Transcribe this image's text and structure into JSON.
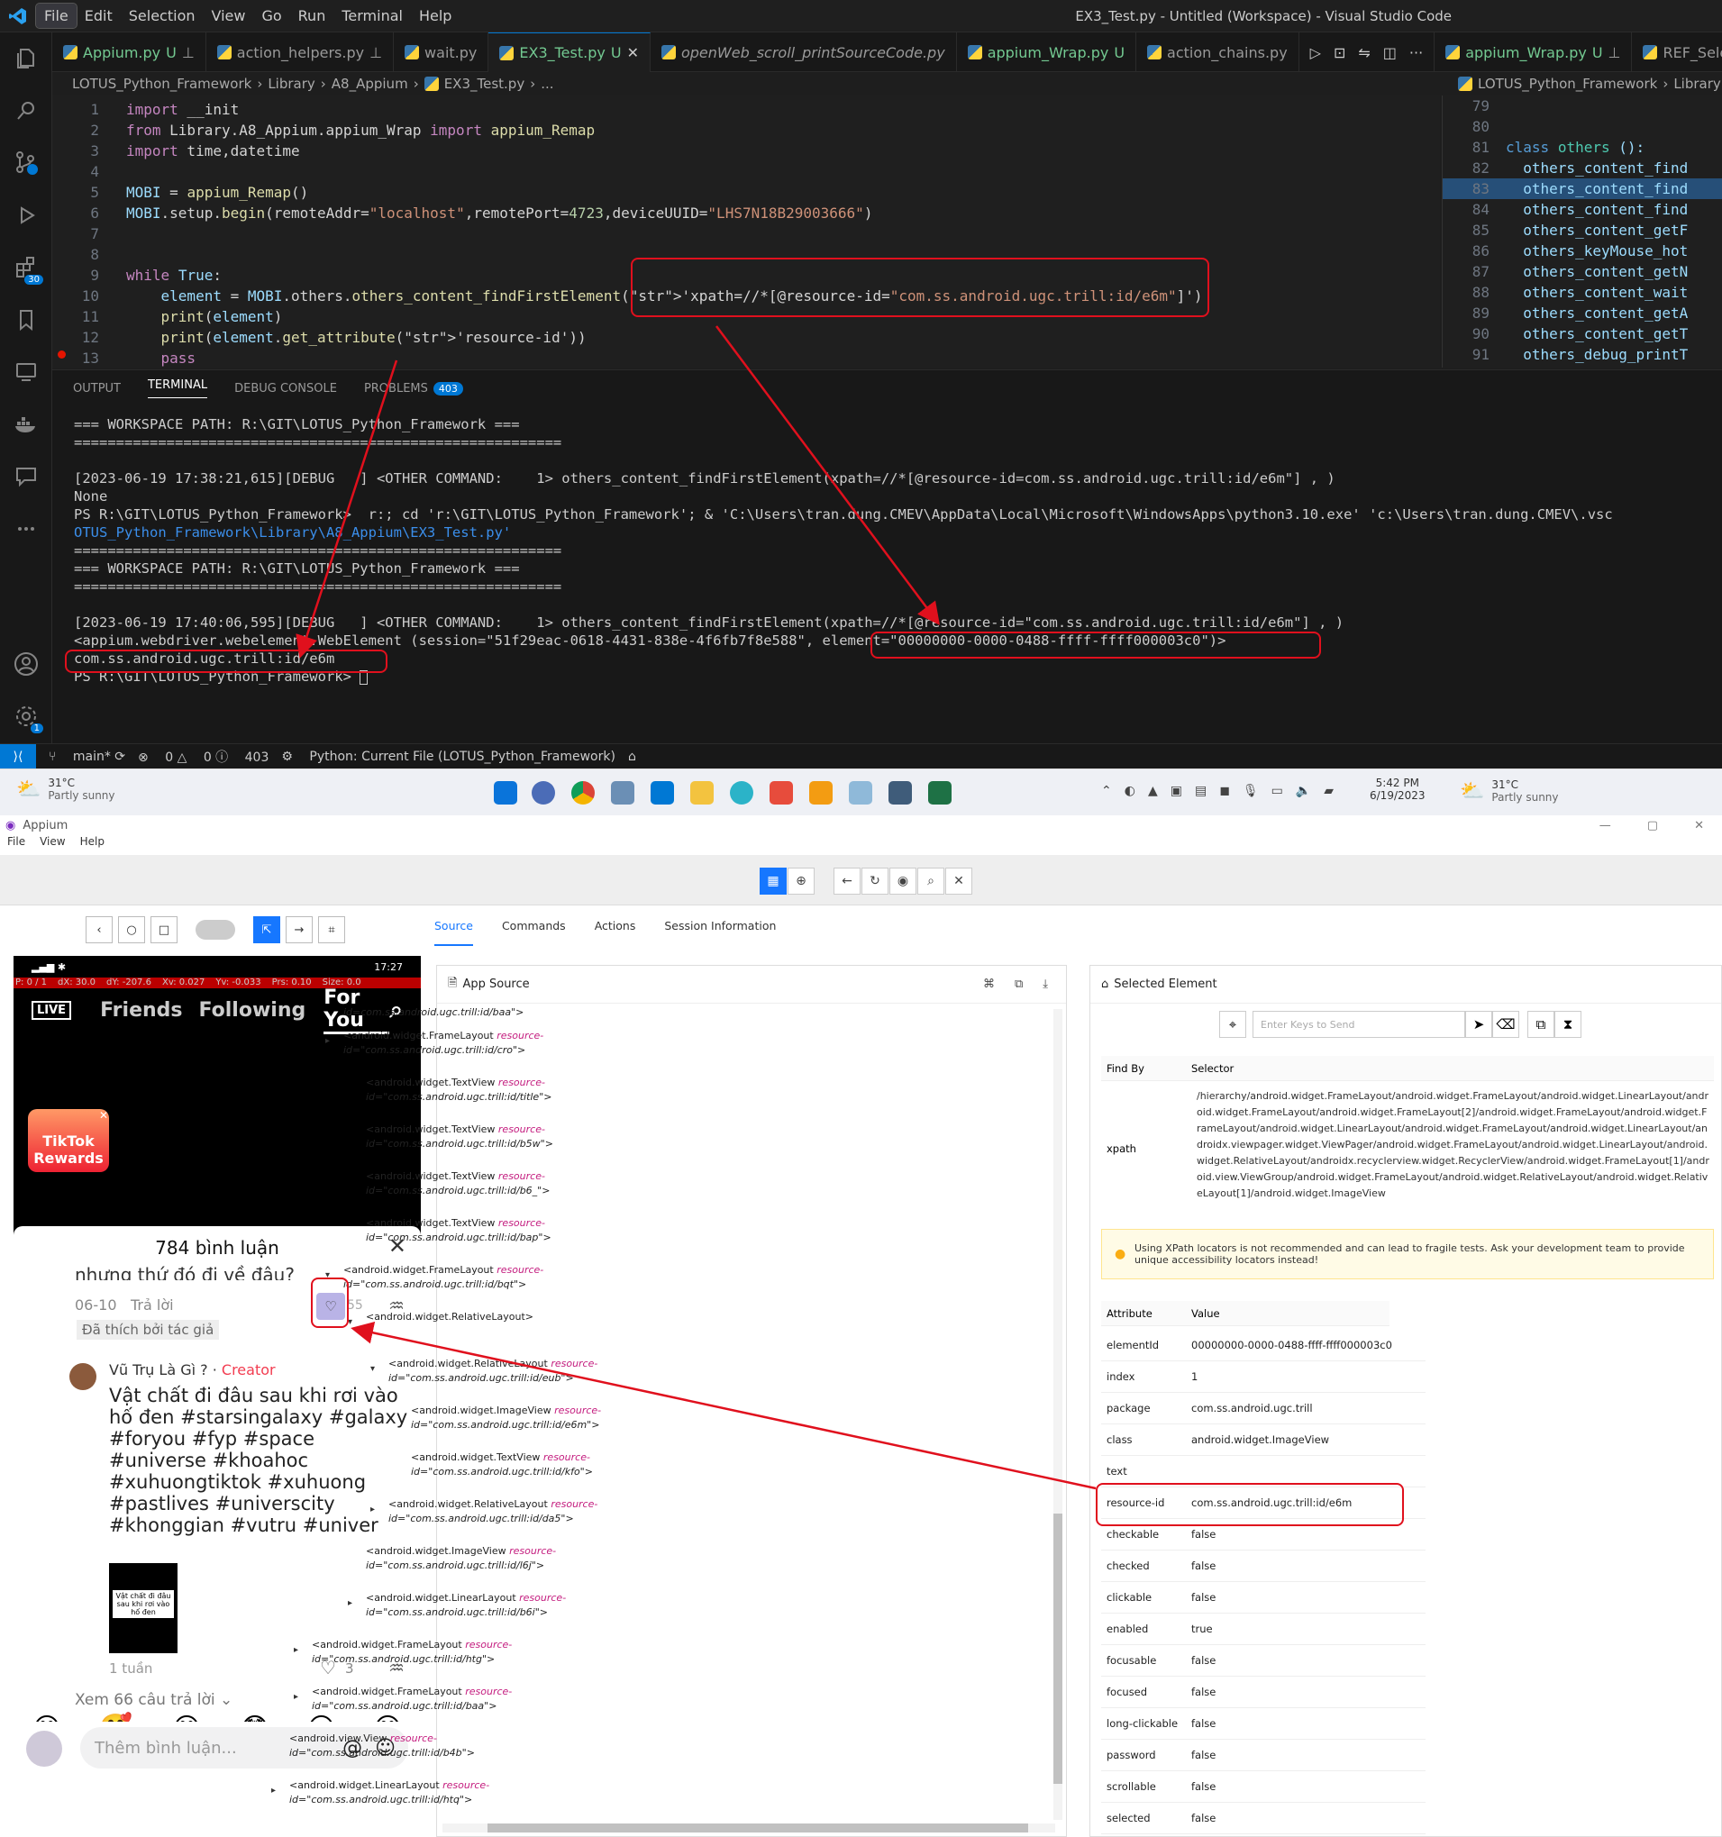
{
  "vscode": {
    "menu": [
      "File",
      "Edit",
      "Selection",
      "View",
      "Go",
      "Run",
      "Terminal",
      "Help"
    ],
    "window_title": "EX3_Test.py - Untitled (Workspace) - Visual Studio Code",
    "tabs": [
      {
        "label": "Appium.py",
        "badge": "U",
        "pinned": true
      },
      {
        "label": "action_helpers.py",
        "badge": "",
        "pinned": true
      },
      {
        "label": "wait.py",
        "badge": "",
        "pinned": false
      },
      {
        "label": "EX3_Test.py",
        "badge": "U",
        "active": true
      },
      {
        "label": "openWeb_scroll_printSourceCode.py",
        "badge": ""
      },
      {
        "label": "appium_Wrap.py",
        "badge": "U"
      },
      {
        "label": "action_chains.py",
        "badge": ""
      }
    ],
    "right_tabs": [
      {
        "label": "appium_Wrap.py",
        "badge": "U"
      },
      {
        "label": "REF_Seleni",
        "badge": ""
      }
    ],
    "breadcrumb": [
      "LOTUS_Python_Framework",
      "Library",
      "A8_Appium",
      "EX3_Test.py",
      "..."
    ],
    "breadcrumb_right": [
      "LOTUS_Python_Framework",
      "Library"
    ],
    "code": [
      {
        "n": "1",
        "t": "import __init"
      },
      {
        "n": "2",
        "t": "from Library.A8_Appium.appium_Wrap import appium_Remap"
      },
      {
        "n": "3",
        "t": "import time,datetime"
      },
      {
        "n": "4",
        "t": ""
      },
      {
        "n": "5",
        "t": "MOBI = appium_Remap()"
      },
      {
        "n": "6",
        "t": "MOBI.setup.begin(remoteAddr=\"localhost\",remotePort=4723,deviceUUID=\"LHS7N18B29003666\")"
      },
      {
        "n": "7",
        "t": ""
      },
      {
        "n": "8",
        "t": ""
      },
      {
        "n": "9",
        "t": "while True:"
      },
      {
        "n": "10",
        "t": "    element = MOBI.others.others_content_findFirstElement('xpath=//*[@resource-id=\"com.ss.android.ugc.trill:id/e6m\"]')"
      },
      {
        "n": "11",
        "t": "    print(element)"
      },
      {
        "n": "12",
        "t": "    print(element.get_attribute('resource-id'))"
      },
      {
        "n": "13",
        "t": "    pass"
      }
    ],
    "code_right": [
      {
        "n": "79",
        "t": ""
      },
      {
        "n": "80",
        "t": ""
      },
      {
        "n": "81",
        "t": "class others ():"
      },
      {
        "n": "82",
        "t": "  others_content_find"
      },
      {
        "n": "83",
        "t": "  others_content_find"
      },
      {
        "n": "84",
        "t": "  others_content_find"
      },
      {
        "n": "85",
        "t": "  others_content_getF"
      },
      {
        "n": "86",
        "t": "  others_keyMouse_hot"
      },
      {
        "n": "87",
        "t": "  others_content_getN"
      },
      {
        "n": "88",
        "t": "  others_content_wait"
      },
      {
        "n": "89",
        "t": "  others_content_getA"
      },
      {
        "n": "90",
        "t": "  others_content_getT"
      },
      {
        "n": "91",
        "t": "  others_debug_printT"
      }
    ],
    "panel_tabs": [
      "OUTPUT",
      "TERMINAL",
      "DEBUG CONSOLE",
      "PROBLEMS"
    ],
    "problems_count": "403",
    "terminal": [
      "=== WORKSPACE PATH: R:\\GIT\\LOTUS_Python_Framework ===",
      "==========================================================",
      "",
      "[2023-06-19 17:38:21,615][DEBUG   ] <OTHER COMMAND:    1> others_content_findFirstElement(xpath=//*[@resource-id=com.ss.android.ugc.trill:id/e6m\"] , )",
      "None",
      "PS R:\\GIT\\LOTUS_Python_Framework>  r:; cd 'r:\\GIT\\LOTUS_Python_Framework'; & 'C:\\Users\\tran.dung.CMEV\\AppData\\Local\\Microsoft\\WindowsApps\\python3.10.exe' 'c:\\Users\\tran.dung.CMEV\\.vsc",
      "OTUS_Python_Framework\\Library\\A8_Appium\\EX3_Test.py'",
      "==========================================================",
      "=== WORKSPACE PATH: R:\\GIT\\LOTUS_Python_Framework ===",
      "==========================================================",
      "",
      "[2023-06-19 17:40:06,595][DEBUG   ] <OTHER COMMAND:    1> others_content_findFirstElement(xpath=//*[@resource-id=\"com.ss.android.ugc.trill:id/e6m\"] , )",
      "<appium.webdriver.webelement.WebElement (session=\"51f29eac-0618-4431-838e-4f6fb7f8e588\", element=\"00000000-0000-0488-ffff-ffff000003c0\")>",
      "com.ss.android.ugc.trill:id/e6m",
      "PS R:\\GIT\\LOTUS_Python_Framework> "
    ],
    "status": {
      "branch": "main*",
      "errors": "0",
      "warnings": "0",
      "info": "403",
      "interpreter": "Python: Current File (LOTUS_Python_Framework)"
    }
  },
  "taskbar": {
    "weather_temp": "31°C",
    "weather_text": "Partly sunny",
    "time": "5:42 PM",
    "date": "6/19/2023"
  },
  "appium": {
    "title": "Appium",
    "menu": [
      "File",
      "View",
      "Help"
    ],
    "tabs": [
      "Source",
      "Commands",
      "Actions",
      "Session Information"
    ],
    "phone": {
      "clock": "17:27",
      "debug": [
        "P: 0 / 1",
        "dX: 30.0",
        "dY: -207.6",
        "Xv: 0.027",
        "Yv: -0.033",
        "Prs: 0.10",
        "Size: 0.0"
      ],
      "nav": [
        "LIVE",
        "Friends",
        "Following",
        "For You"
      ],
      "rewards": "TikTok Rewards",
      "comments_header": "784 bình luận",
      "c1_text": "nhưng thứ đó đi về đâu?",
      "c1_date": "06-10",
      "c1_reply": "Trả lời",
      "c1_likes": "55",
      "c1_tag": "Đã thích bởi tác giả",
      "c2_author": "Vũ Trụ Là Gì ?",
      "c2_role": "Creator",
      "c2_text": "Vật chất đi đâu sau khi rơi vào hố đen #starsingalaxy #galaxy #foryou #fyp #space #universe #khoahoc #xuhuongtiktok #xuhuong #pastlives #universcity #khonggian #vutru #univer",
      "c2_thumb_title": "Vật chất đi đâu sau khi rơi vào hố đen",
      "c2_date": "1 tuần",
      "c2_likes": "3",
      "more_replies": "Xem 66 câu trả lời",
      "emojis": [
        "😁",
        "🥰",
        "😂",
        "😳",
        "😏",
        "😅"
      ],
      "input_placeholder": "Thêm bình luận..."
    },
    "source_title": "App Source",
    "source_nodes": [
      {
        "tag": "",
        "id": "com.ss.android.ugc.trill:id/baa\">"
      },
      {
        "tag": "<android.widget.FrameLayout",
        "id": "com.ss.android.ugc.trill:id/cro\">"
      },
      {
        "tag": "<android.widget.TextView",
        "id": "com.ss.android.ugc.trill:id/title\">"
      },
      {
        "tag": "<android.widget.TextView",
        "id": "com.ss.android.ugc.trill:id/b5w\">"
      },
      {
        "tag": "<android.widget.TextView",
        "id": "com.ss.android.ugc.trill:id/b6_\">"
      },
      {
        "tag": "<android.widget.TextView",
        "id": "com.ss.android.ugc.trill:id/bap\">"
      },
      {
        "tag": "<android.widget.FrameLayout",
        "id": "com.ss.android.ugc.trill:id/bqt\">"
      },
      {
        "tag": "<android.widget.RelativeLayout>",
        "id": ""
      },
      {
        "tag": "<android.widget.RelativeLayout",
        "id": "com.ss.android.ugc.trill:id/eub\">"
      },
      {
        "tag": "<android.widget.ImageView",
        "id": "com.ss.android.ugc.trill:id/e6m\">"
      },
      {
        "tag": "<android.widget.TextView",
        "id": "com.ss.android.ugc.trill:id/kfo\">"
      },
      {
        "tag": "<android.widget.RelativeLayout",
        "id": "com.ss.android.ugc.trill:id/da5\">"
      },
      {
        "tag": "<android.widget.ImageView",
        "id": "com.ss.android.ugc.trill:id/l6j\">"
      },
      {
        "tag": "<android.widget.LinearLayout",
        "id": "com.ss.android.ugc.trill:id/b6i\">"
      },
      {
        "tag": "<android.widget.FrameLayout",
        "id": "com.ss.android.ugc.trill:id/htg\">"
      },
      {
        "tag": "<android.widget.FrameLayout",
        "id": "com.ss.android.ugc.trill:id/baa\">"
      },
      {
        "tag": "<android.view.View",
        "id": "com.ss.android.ugc.trill:id/b4b\">"
      },
      {
        "tag": "<android.widget.LinearLayout",
        "id": "com.ss.android.ugc.trill:id/htq\">"
      }
    ],
    "resource_attr": "resource-",
    "id_attr": "id=",
    "selected_title": "Selected Element",
    "keys_placeholder": "Enter Keys to Send",
    "findby_header": [
      "Find By",
      "Selector"
    ],
    "xpath_label": "xpath",
    "xpath_value": "/hierarchy/android.widget.FrameLayout/android.widget.FrameLayout/android.widget.LinearLayout/android.widget.FrameLayout/android.widget.FrameLayout[2]/android.widget.FrameLayout/android.widget.FrameLayout/android.widget.LinearLayout/android.widget.FrameLayout/android.widget.LinearLayout/androidx.viewpager.widget.ViewPager/android.widget.FrameLayout/android.widget.LinearLayout/android.widget.RelativeLayout/androidx.recyclerview.widget.RecyclerView/android.widget.FrameLayout[1]/android.view.ViewGroup/android.widget.FrameLayout/android.widget.RelativeLayout/android.widget.RelativeLayout[1]/android.widget.ImageView",
    "warning": "Using XPath locators is not recommended and can lead to fragile tests. Ask your development team to provide unique accessibility locators instead!",
    "attr_header": [
      "Attribute",
      "Value"
    ],
    "attributes": [
      {
        "k": "elementId",
        "v": "00000000-0000-0488-ffff-ffff000003c0"
      },
      {
        "k": "index",
        "v": "1"
      },
      {
        "k": "package",
        "v": "com.ss.android.ugc.trill"
      },
      {
        "k": "class",
        "v": "android.widget.ImageView"
      },
      {
        "k": "text",
        "v": ""
      },
      {
        "k": "resource-id",
        "v": "com.ss.android.ugc.trill:id/e6m"
      },
      {
        "k": "checkable",
        "v": "false"
      },
      {
        "k": "checked",
        "v": "false"
      },
      {
        "k": "clickable",
        "v": "false"
      },
      {
        "k": "enabled",
        "v": "true"
      },
      {
        "k": "focusable",
        "v": "false"
      },
      {
        "k": "focused",
        "v": "false"
      },
      {
        "k": "long-clickable",
        "v": "false"
      },
      {
        "k": "password",
        "v": "false"
      },
      {
        "k": "scrollable",
        "v": "false"
      },
      {
        "k": "selected",
        "v": "false"
      }
    ]
  },
  "colors": {
    "annotation": "#e0101d",
    "accent": "#0078d4",
    "appium_blue": "#1677ff"
  }
}
